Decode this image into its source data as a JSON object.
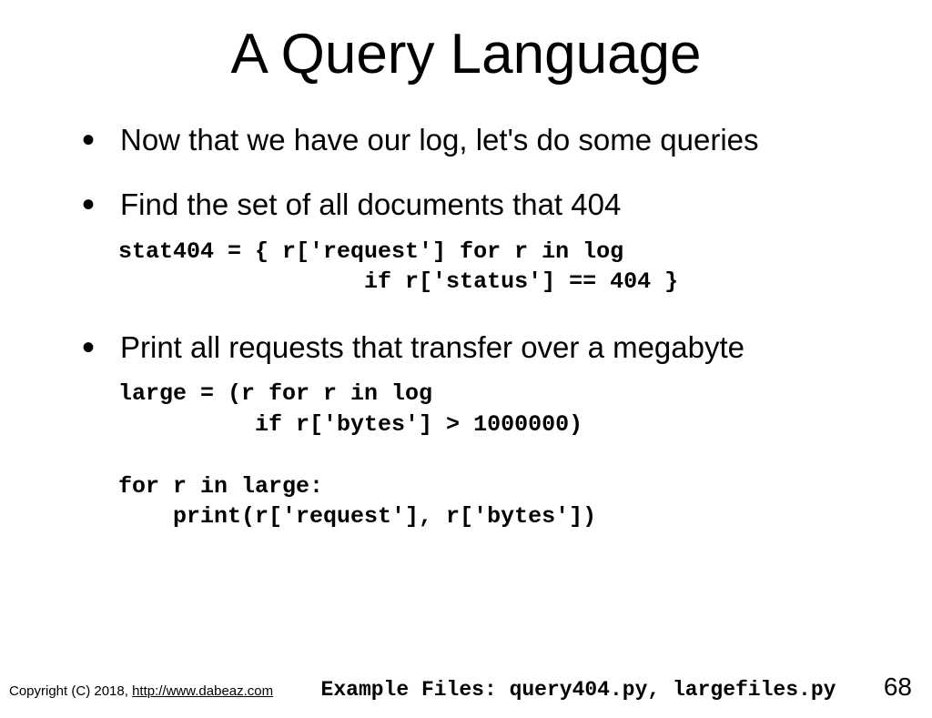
{
  "title": "A Query Language",
  "bullets": [
    "Now that we have our log, let's do some queries",
    "Find the set of all documents that 404",
    "Print all requests that transfer over a megabyte"
  ],
  "code1": "stat404 = { r['request'] for r in log\n                  if r['status'] == 404 }",
  "code2": "large = (r for r in log\n          if r['bytes'] > 1000000)\n\nfor r in large:\n    print(r['request'], r['bytes'])",
  "footer": {
    "copyright_prefix": "Copyright (C) 2018,  ",
    "copyright_link": "http://www.dabeaz.com",
    "example_files": "Example Files: query404.py, largefiles.py",
    "page": "68"
  }
}
